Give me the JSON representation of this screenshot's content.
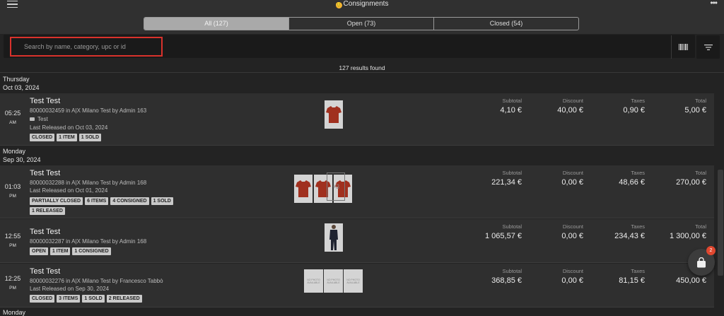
{
  "header": {
    "title": "Consignments",
    "logo_glyph": "😊",
    "more_glyph": "•••"
  },
  "tabs": [
    {
      "label": "All (127)",
      "active": true
    },
    {
      "label": "Open (73)",
      "active": false
    },
    {
      "label": "Closed (54)",
      "active": false
    }
  ],
  "search": {
    "placeholder": "Search by name, category, upc or id",
    "value": ""
  },
  "results_text": "127 results found",
  "amount_labels": {
    "subtotal": "Subtotal",
    "discount": "Discount",
    "taxes": "Taxes",
    "total": "Total"
  },
  "days": [
    {
      "weekday": "Thursday",
      "date": "Oct 03, 2024"
    },
    {
      "weekday": "Monday",
      "date": "Sep 30, 2024"
    },
    {
      "weekday": "Monday"
    }
  ],
  "rows": [
    {
      "time": "05:25",
      "ampm": "AM",
      "name": "Test Test",
      "line1": "80000032459 in A|X Milano Test by Admin 163",
      "folder": "Test",
      "line2": "Last Released on Oct 03, 2024",
      "tags": [
        "CLOSED",
        "1 ITEM",
        "1 SOLD"
      ],
      "subtotal": "4,10 €",
      "discount": "40,00 €",
      "taxes": "0,90 €",
      "total": "5,00 €"
    },
    {
      "time": "01:03",
      "ampm": "PM",
      "name": "Test Test",
      "line1": "80000032288 in A|X Milano Test by Admin 168",
      "line2": "Last Released on Oct 01, 2024",
      "tags": [
        "PARTIALLY CLOSED",
        "6 ITEMS",
        "4 CONSIGNED",
        "1 SOLD",
        "1 RELEASED"
      ],
      "more_count": "+3",
      "subtotal": "221,34 €",
      "discount": "0,00 €",
      "taxes": "48,66 €",
      "total": "270,00 €"
    },
    {
      "time": "12:55",
      "ampm": "PM",
      "name": "Test Test",
      "line1": "80000032287 in A|X Milano Test by Admin 168",
      "tags": [
        "OPEN",
        "1 ITEM",
        "1 CONSIGNED"
      ],
      "subtotal": "1 065,57 €",
      "discount": "0,00 €",
      "taxes": "234,43 €",
      "total": "1 300,00 €"
    },
    {
      "time": "12:25",
      "ampm": "PM",
      "name": "Test Test",
      "line1": "80000032276 in A|X Milano Test by Francesco Tabbò",
      "line2": "Last Released on Sep 30, 2024",
      "tags": [
        "CLOSED",
        "3 ITEMS",
        "1 SOLD",
        "2 RELEASED"
      ],
      "no_photo_text": "NO PHOTO AVAILABLE",
      "subtotal": "368,85 €",
      "discount": "0,00 €",
      "taxes": "81,15 €",
      "total": "450,00 €"
    }
  ],
  "cart": {
    "badge": "2"
  },
  "colors": {
    "background": "#232323",
    "row": "#2f2f2f",
    "highlight": "#d9322c",
    "badge": "#e0472f",
    "shirt": "#a0301f"
  }
}
